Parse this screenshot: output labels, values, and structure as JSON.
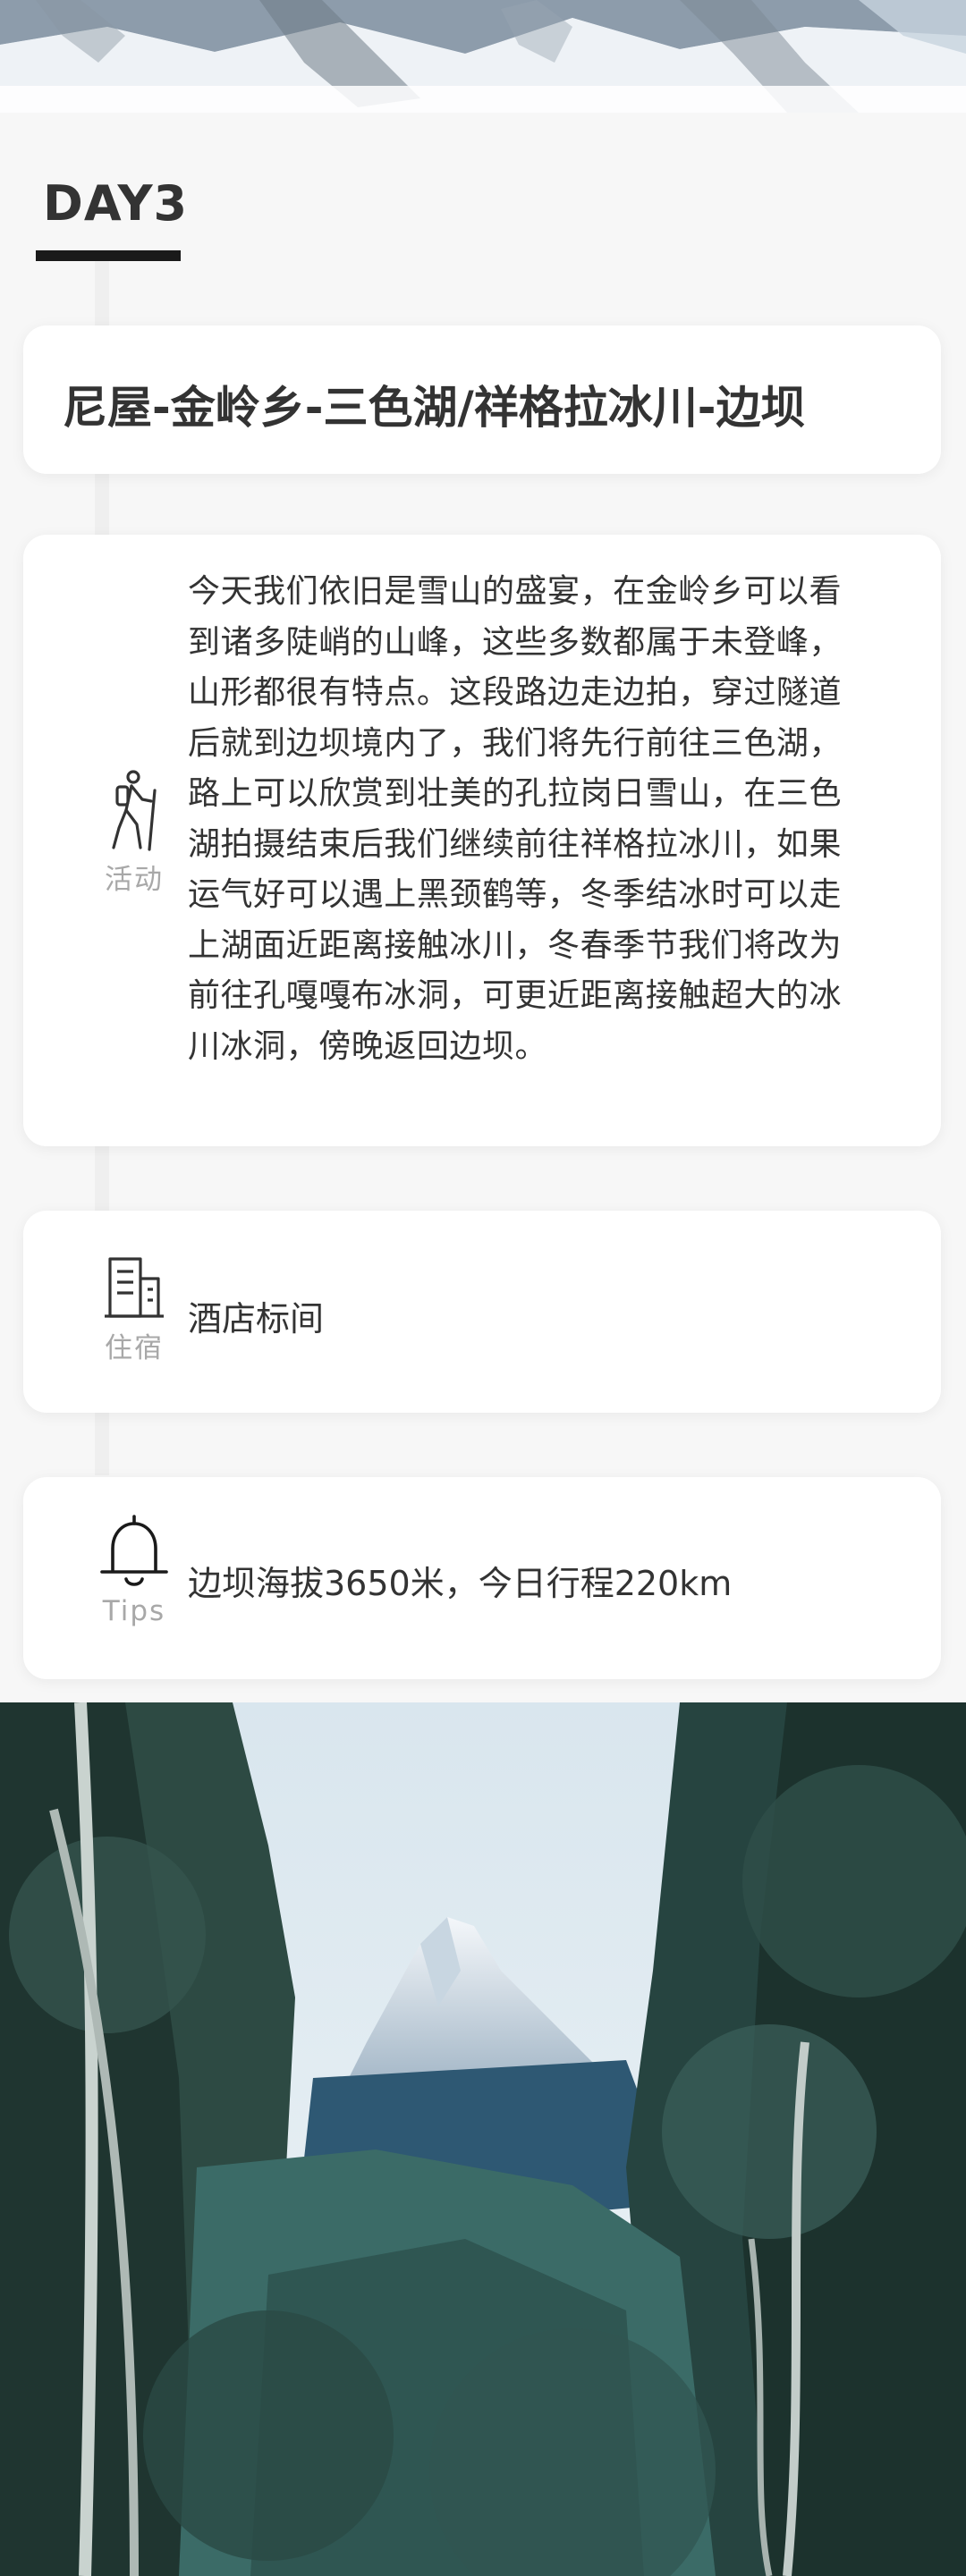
{
  "day": {
    "label": "DAY3"
  },
  "route": {
    "title": "尼屋-金岭乡-三色湖/祥格拉冰川-边坝"
  },
  "activity": {
    "icon": "hiker-icon",
    "label": "活动",
    "lines": [
      "今天我们依旧是雪山的盛宴，在金岭乡可以看",
      "到诸多陡峭的山峰，这些多数都属于未登峰，",
      "山形都很有特点。这段路边走边拍，穿过隧道",
      "后就到边坝境内了，我们将先行前往三色湖，",
      "路上可以欣赏到壮美的孔拉岗日雪山，在三色",
      "湖拍摄结束后我们继续前往祥格拉冰川，如果",
      "运气好可以遇上黑颈鹤等，冬季结冰时可以走",
      "上湖面近距离接触冰川，冬春季节我们将改为",
      "前往孔嘎嘎布冰洞，可更近距离接触超大的冰",
      "川冰洞，傍晚返回边坝。"
    ]
  },
  "stay": {
    "icon": "building-icon",
    "label": "住宿",
    "text": "酒店标间"
  },
  "tips": {
    "icon": "bell-icon",
    "label": "Tips",
    "text": "边坝海拔3650米，今日行程220km"
  },
  "colors": {
    "accent": "#1a1a1a",
    "text": "#333333",
    "muted": "#a8a8a8",
    "timeline": "#efefef"
  }
}
